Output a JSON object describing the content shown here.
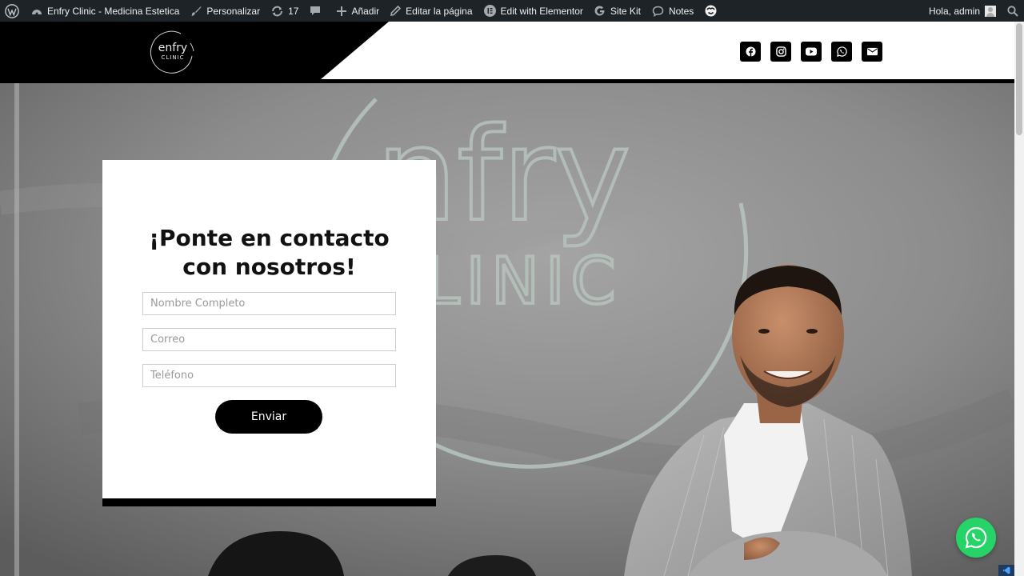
{
  "adminbar": {
    "site_name": "Enfry Clinic - Medicina Estetica",
    "customize": "Personalizar",
    "updates_count": "17",
    "add_new": "Añadir",
    "edit_page": "Editar la página",
    "elementor": "Edit with Elementor",
    "site_kit": "Site Kit",
    "notes": "Notes",
    "greeting": "Hola, admin"
  },
  "header": {
    "logo_text_top": "enfry",
    "logo_text_bottom": "CLINIC",
    "social_icons": [
      "facebook-icon",
      "instagram-icon",
      "youtube-icon",
      "whatsapp-icon",
      "envelope-icon"
    ]
  },
  "hero": {
    "wall_text_top": "nfry",
    "wall_text_bottom": "LINIC"
  },
  "form": {
    "title_line1": "¡Ponte en contacto",
    "title_line2": "con nosotros!",
    "name_placeholder": "Nombre Completo",
    "email_placeholder": "Correo",
    "phone_placeholder": "Teléfono",
    "submit_label": "Enviar"
  },
  "colors": {
    "adminbar_bg": "#1d2327",
    "brand_black": "#000000",
    "whatsapp_green": "#25d366"
  }
}
